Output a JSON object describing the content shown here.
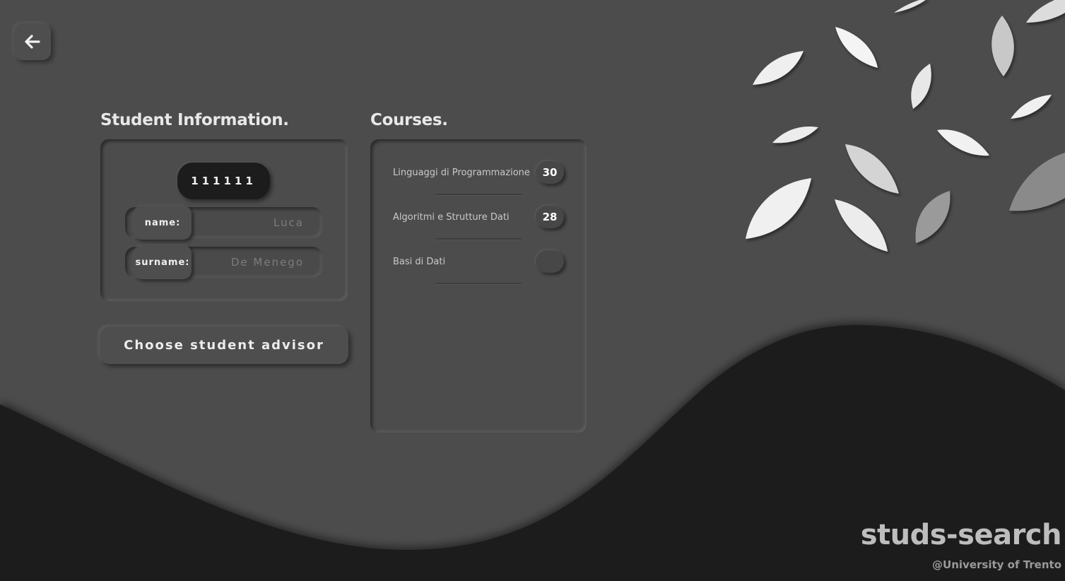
{
  "navigation": {
    "back_icon": "arrow-left-icon"
  },
  "student": {
    "section_title": "Student Information.",
    "id": "111111",
    "name_label": "name:",
    "name_value": "Luca",
    "surname_label": "surname:",
    "surname_value": "De Menego"
  },
  "actions": {
    "advisor_label": "Choose student advisor"
  },
  "courses": {
    "section_title": "Courses.",
    "items": [
      {
        "name": "Linguaggi di Programmazione",
        "grade": "30"
      },
      {
        "name": "Algoritmi e Strutture Dati",
        "grade": "28"
      },
      {
        "name": "Basi di Dati",
        "grade": ""
      }
    ]
  },
  "branding": {
    "title": "studs-search",
    "subtitle": "@University of Trento"
  },
  "colors": {
    "background": "#4c4c4c",
    "wave": "#1f1f1f",
    "id_pill": "#1c1c1c",
    "leaf": "#f2f2f2"
  }
}
